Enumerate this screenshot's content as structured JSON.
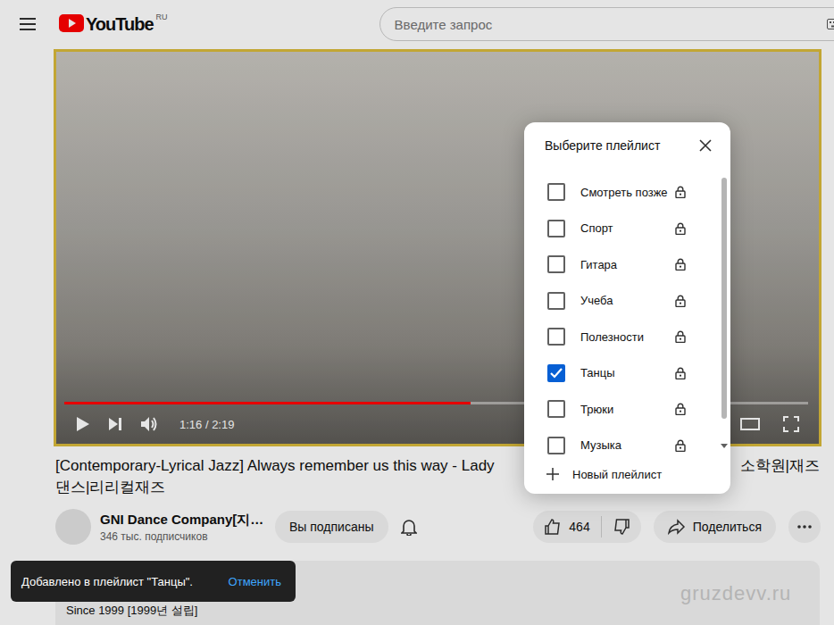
{
  "header": {
    "logo": "YouTube",
    "region": "RU",
    "search": {
      "placeholder": "Введите запрос"
    }
  },
  "player": {
    "level": 0.546,
    "time": "1:16 / 2:19"
  },
  "video": {
    "title_start": "[Contemporary-Lyrical Jazz] Always remember us this way - Lady",
    "title_end": "소학원|재즈",
    "title_line2": "댄스|리리컬재즈"
  },
  "channel": {
    "name": "GNI Dance Company[지…",
    "subscribers": "346 тыс. подписчиков",
    "subscribe_button": "Вы подписаны"
  },
  "actions": {
    "likes": "464",
    "share": "Поделиться"
  },
  "description": {
    "text": "Since 1999 [1999년 설립]"
  },
  "watermark": "gruzdevv.ru",
  "playlist_dialog": {
    "title": "Выберите плейлист",
    "items": [
      {
        "label": "Смотреть позже",
        "checked": false,
        "private": true
      },
      {
        "label": "Спорт",
        "checked": false,
        "private": true
      },
      {
        "label": "Гитара",
        "checked": false,
        "private": true
      },
      {
        "label": "Учеба",
        "checked": false,
        "private": true
      },
      {
        "label": "Полезности",
        "checked": false,
        "private": true
      },
      {
        "label": "Танцы",
        "checked": true,
        "private": true
      },
      {
        "label": "Трюки",
        "checked": false,
        "private": true
      },
      {
        "label": "Музыка",
        "checked": false,
        "private": true
      }
    ],
    "new_playlist": "Новый плейлист"
  },
  "toast": {
    "message": "Добавлено в плейлист \"Танцы\".",
    "action": "Отменить"
  }
}
